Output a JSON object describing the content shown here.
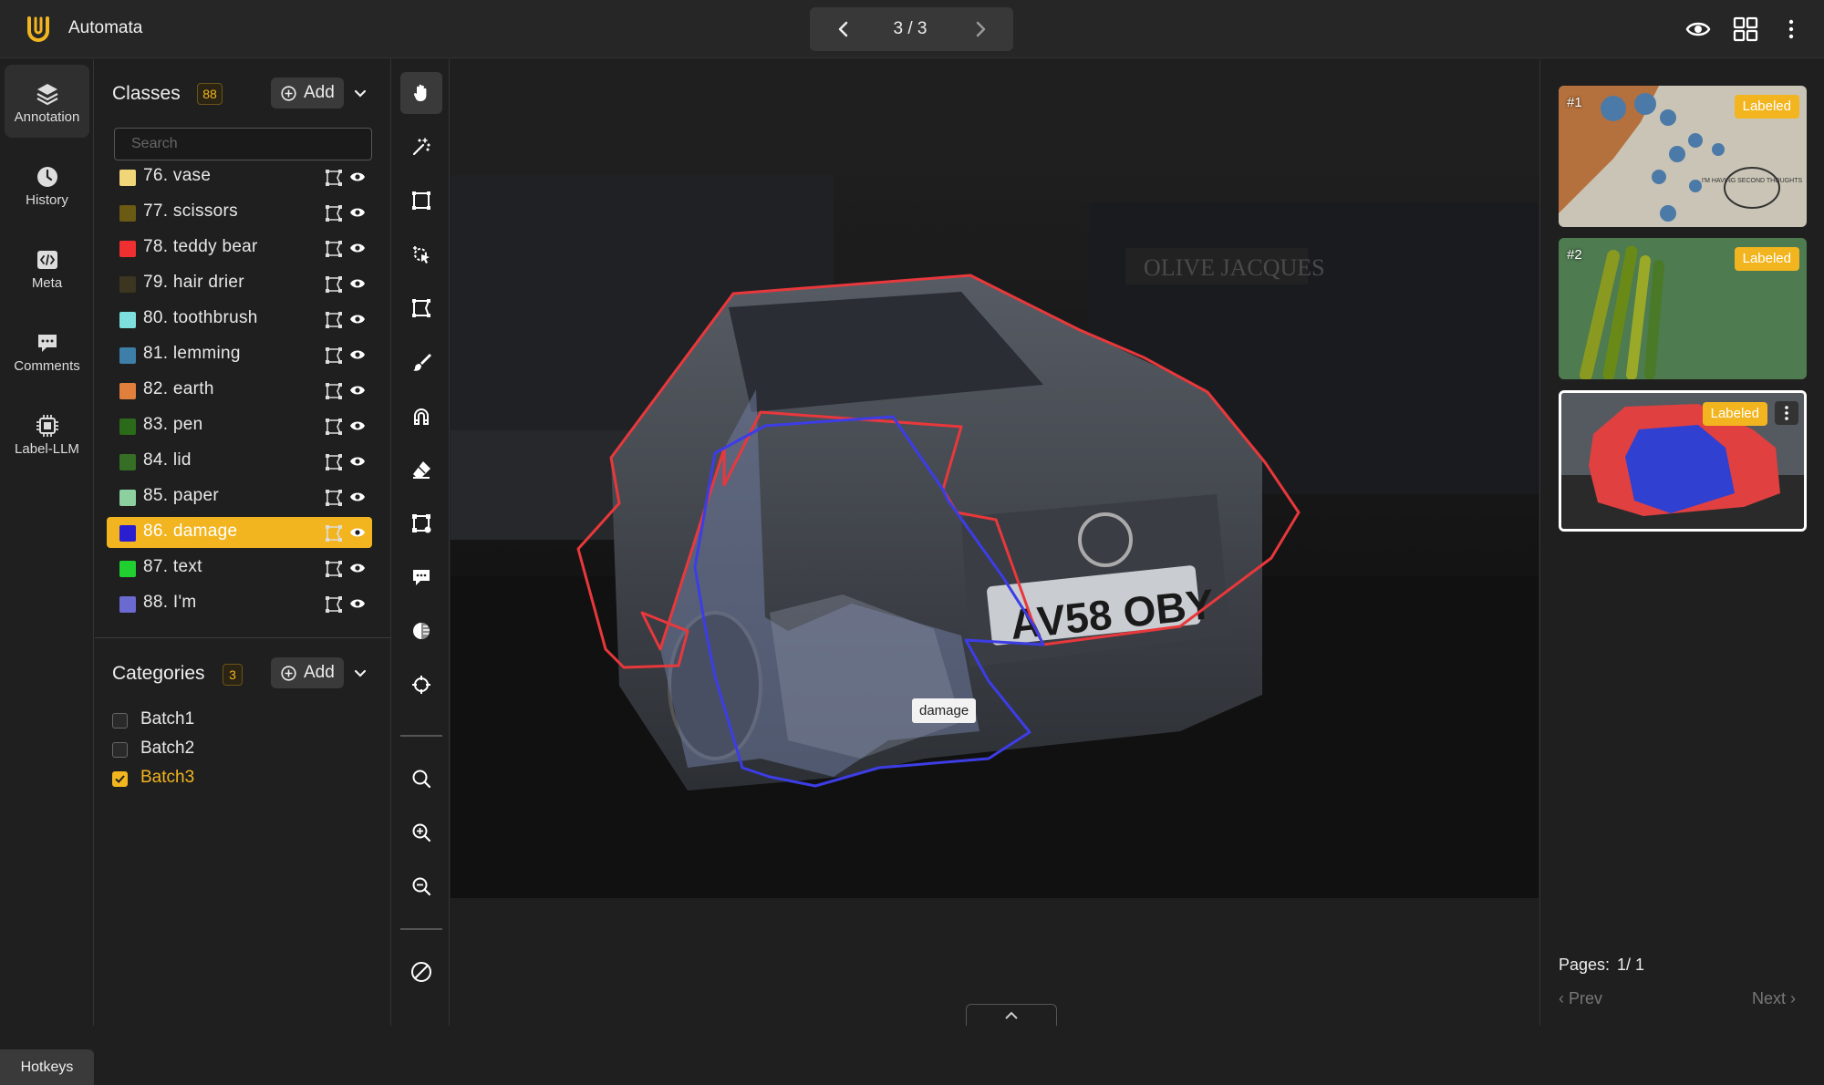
{
  "app": {
    "title": "Automata"
  },
  "pager": {
    "text": "3 / 3"
  },
  "nav": {
    "items": [
      {
        "label": "Annotation",
        "icon": "layers-icon"
      },
      {
        "label": "History",
        "icon": "clock-icon"
      },
      {
        "label": "Meta",
        "icon": "code-icon"
      },
      {
        "label": "Comments",
        "icon": "chat-icon"
      },
      {
        "label": "Label-LLM",
        "icon": "chip-icon"
      }
    ],
    "hotkeys": "Hotkeys"
  },
  "classes": {
    "title": "Classes",
    "count": "88",
    "add_label": "Add",
    "search_placeholder": "Search",
    "items": [
      {
        "label": "76. vase",
        "color": "#f0d678"
      },
      {
        "label": "77. scissors",
        "color": "#6b5a14"
      },
      {
        "label": "78. teddy bear",
        "color": "#f03030"
      },
      {
        "label": "79. hair drier",
        "color": "#3c3520"
      },
      {
        "label": "80. toothbrush",
        "color": "#7ee0de"
      },
      {
        "label": "81. lemming",
        "color": "#3d7fa8"
      },
      {
        "label": "82. earth",
        "color": "#e0803c"
      },
      {
        "label": "83. pen",
        "color": "#2a6a18"
      },
      {
        "label": "84. lid",
        "color": "#356e24"
      },
      {
        "label": "85. paper",
        "color": "#8cd0a0"
      },
      {
        "label": "86. damage",
        "color": "#2a1fd0"
      },
      {
        "label": "87. text",
        "color": "#20d030"
      },
      {
        "label": "88. I'm",
        "color": "#6a6ad0"
      }
    ],
    "selected": "86. damage"
  },
  "categories": {
    "title": "Categories",
    "count": "3",
    "add_label": "Add",
    "items": [
      {
        "label": "Batch1",
        "checked": false
      },
      {
        "label": "Batch2",
        "checked": false
      },
      {
        "label": "Batch3",
        "checked": true
      }
    ]
  },
  "tools": [
    "pan-hand-icon",
    "magic-wand-icon",
    "bounding-box-icon",
    "smart-select-icon",
    "polygon-icon",
    "brush-icon",
    "magnet-icon",
    "eraser-icon",
    "keypoints-icon",
    "comment-icon",
    "contrast-icon",
    "crosshair-icon",
    "search-icon",
    "zoom-in-icon",
    "zoom-out-icon",
    "clear-icon"
  ],
  "canvas": {
    "tooltip": "damage",
    "plate": "AV58 OBY",
    "storefront": "OLIVE JACQUES"
  },
  "thumbnails": [
    {
      "num": "#1",
      "badge": "Labeled",
      "thumb_text": "I'M HAVING SECOND THOUGHTS"
    },
    {
      "num": "#2",
      "badge": "Labeled"
    },
    {
      "num": "",
      "badge": "Labeled"
    }
  ],
  "pagination": {
    "label": "Pages:",
    "value": "1/ 1",
    "prev": "‹  Prev",
    "next": "Next  ›"
  },
  "colors": {
    "accent": "#f2b51f",
    "outline_car": "#e8383c",
    "outline_damage": "#3d3de6"
  }
}
